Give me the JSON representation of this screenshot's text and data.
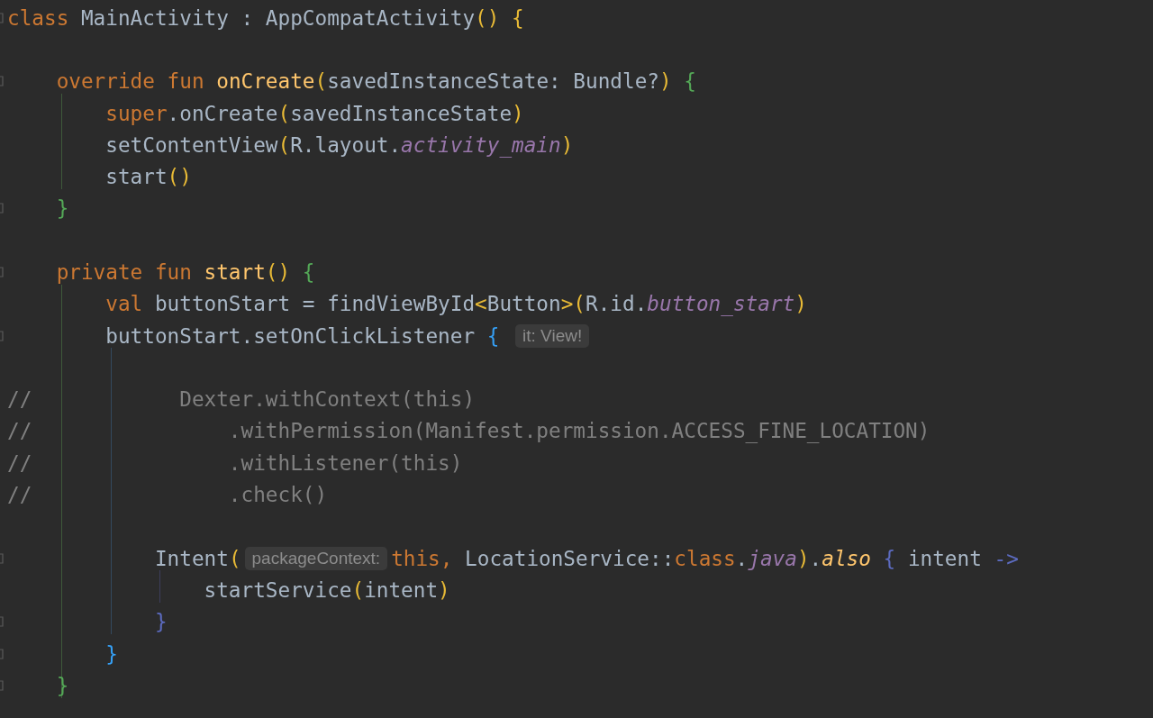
{
  "editor": {
    "lines": [
      {
        "fold": true,
        "tokens": [
          {
            "kind": "kw",
            "text": "class"
          },
          {
            "kind": "pl",
            "text": " MainActivity : AppCompatActivity"
          },
          {
            "kind": "par",
            "text": "() "
          },
          {
            "kind": "b1",
            "text": "{"
          }
        ]
      },
      {
        "fold": false
      },
      {
        "fold": true,
        "tokens": [
          {
            "kind": "kw",
            "text": "    override fun "
          },
          {
            "kind": "fn",
            "text": "onCreate"
          },
          {
            "kind": "par",
            "text": "("
          },
          {
            "kind": "pl",
            "text": "savedInstanceState: Bundle?"
          },
          {
            "kind": "par",
            "text": ") "
          },
          {
            "kind": "b2",
            "text": "{"
          }
        ]
      },
      {
        "fold": false,
        "tokens": [
          {
            "kind": "kw",
            "text": "        super"
          },
          {
            "kind": "pl",
            "text": ".onCreate"
          },
          {
            "kind": "par",
            "text": "("
          },
          {
            "kind": "pl",
            "text": "savedInstanceState"
          },
          {
            "kind": "par",
            "text": ")"
          }
        ]
      },
      {
        "fold": false,
        "tokens": [
          {
            "kind": "pl",
            "text": "        setContentView"
          },
          {
            "kind": "par",
            "text": "("
          },
          {
            "kind": "pl",
            "text": "R.layout."
          },
          {
            "kind": "it",
            "text": "activity_main"
          },
          {
            "kind": "par",
            "text": ")"
          }
        ]
      },
      {
        "fold": false,
        "tokens": [
          {
            "kind": "pl",
            "text": "        start"
          },
          {
            "kind": "par",
            "text": "()"
          }
        ]
      },
      {
        "fold": true,
        "tokens": [
          {
            "kind": "b2",
            "text": "    }"
          }
        ]
      },
      {
        "fold": false
      },
      {
        "fold": true,
        "tokens": [
          {
            "kind": "kw",
            "text": "    private fun "
          },
          {
            "kind": "fn",
            "text": "start"
          },
          {
            "kind": "par",
            "text": "() "
          },
          {
            "kind": "b2",
            "text": "{"
          }
        ]
      },
      {
        "fold": false,
        "tokens": [
          {
            "kind": "kw",
            "text": "        val"
          },
          {
            "kind": "pl",
            "text": " buttonStart = findViewById"
          },
          {
            "kind": "par",
            "text": "<"
          },
          {
            "kind": "pl",
            "text": "Button"
          },
          {
            "kind": "par",
            "text": ">("
          },
          {
            "kind": "pl",
            "text": "R.id."
          },
          {
            "kind": "it",
            "text": "button_start"
          },
          {
            "kind": "par",
            "text": ")"
          }
        ]
      },
      {
        "fold": true,
        "tokens": [
          {
            "kind": "pl",
            "text": "        buttonStart.setOnClickListener "
          },
          {
            "kind": "b3",
            "text": "{ "
          },
          {
            "kind": "hint",
            "text": "it: View!"
          }
        ]
      },
      {
        "fold": false
      },
      {
        "fold": false,
        "tokens": [
          {
            "kind": "cm",
            "text": "//            Dexter.withContext(this)"
          }
        ]
      },
      {
        "fold": false,
        "tokens": [
          {
            "kind": "cm",
            "text": "//                .withPermission(Manifest.permission.ACCESS_FINE_LOCATION)"
          }
        ]
      },
      {
        "fold": false,
        "tokens": [
          {
            "kind": "cm",
            "text": "//                .withListener(this)"
          }
        ]
      },
      {
        "fold": false,
        "tokens": [
          {
            "kind": "cm",
            "text": "//                .check()"
          }
        ]
      },
      {
        "fold": false
      },
      {
        "fold": true,
        "tokens": [
          {
            "kind": "pl",
            "text": "            Intent"
          },
          {
            "kind": "par",
            "text": "("
          },
          {
            "kind": "hint",
            "text": "packageContext:"
          },
          {
            "kind": "kw",
            "text": "this,"
          },
          {
            "kind": "pl",
            "text": " LocationService::"
          },
          {
            "kind": "kw",
            "text": "class"
          },
          {
            "kind": "pl",
            "text": "."
          },
          {
            "kind": "it",
            "text": "java"
          },
          {
            "kind": "par",
            "text": ")"
          },
          {
            "kind": "pl",
            "text": "."
          },
          {
            "kind": "ity",
            "text": "also"
          },
          {
            "kind": "b4",
            "text": " {"
          },
          {
            "kind": "pl",
            "text": " intent "
          },
          {
            "kind": "b4",
            "text": "->"
          }
        ]
      },
      {
        "fold": false,
        "tokens": [
          {
            "kind": "pl",
            "text": "                startService"
          },
          {
            "kind": "par",
            "text": "("
          },
          {
            "kind": "pl",
            "text": "intent"
          },
          {
            "kind": "par",
            "text": ")"
          }
        ]
      },
      {
        "fold": true,
        "tokens": [
          {
            "kind": "b4",
            "text": "            }"
          }
        ]
      },
      {
        "fold": true,
        "tokens": [
          {
            "kind": "b3",
            "text": "        }"
          }
        ]
      },
      {
        "fold": true,
        "tokens": [
          {
            "kind": "b2",
            "text": "    }"
          }
        ]
      }
    ]
  }
}
